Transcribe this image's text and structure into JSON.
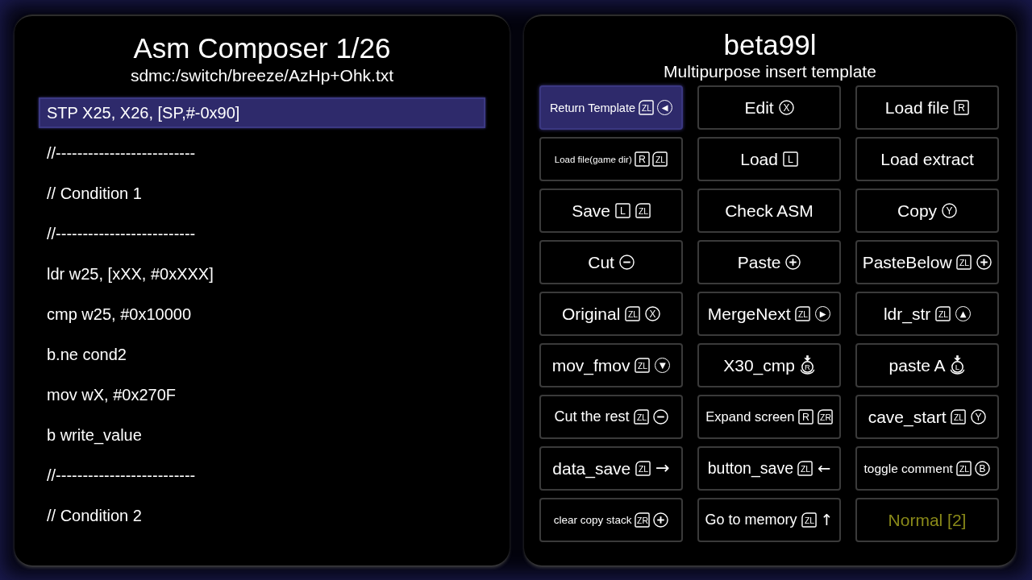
{
  "editor": {
    "title": "Asm Composer 1/26",
    "path": "sdmc:/switch/breeze/AzHp+Ohk.txt",
    "lines": [
      {
        "text": "STP X25, X26, [SP,#-0x90]",
        "selected": true
      },
      {
        "text": "//--------------------------",
        "selected": false
      },
      {
        "text": "// Condition 1",
        "selected": false
      },
      {
        "text": "//--------------------------",
        "selected": false
      },
      {
        "text": "ldr w25, [xXX, #0xXXX]",
        "selected": false
      },
      {
        "text": "cmp w25, #0x10000",
        "selected": false
      },
      {
        "text": "b.ne cond2",
        "selected": false
      },
      {
        "text": "mov wX, #0x270F",
        "selected": false
      },
      {
        "text": "b write_value",
        "selected": false
      },
      {
        "text": "//--------------------------",
        "selected": false
      },
      {
        "text": "// Condition 2",
        "selected": false
      }
    ]
  },
  "template": {
    "title": "beta99l",
    "subtitle": "Multipurpose insert template",
    "buttons": [
      {
        "label": "Return Template",
        "keys": [
          {
            "kind": "trigger",
            "text": "ZL"
          },
          {
            "kind": "dpad",
            "text": "◀"
          }
        ],
        "selected": true,
        "color": "#ffffff"
      },
      {
        "label": "Edit",
        "keys": [
          {
            "kind": "face",
            "text": "X"
          }
        ],
        "selected": false,
        "color": "#ffffff"
      },
      {
        "label": "Load file",
        "keys": [
          {
            "kind": "bumper",
            "text": "R"
          }
        ],
        "selected": false,
        "color": "#ffffff"
      },
      {
        "label": "Load file(game dir)",
        "keys": [
          {
            "kind": "bumper",
            "text": "R"
          },
          {
            "kind": "trigger",
            "text": "ZL"
          }
        ],
        "selected": false,
        "color": "#ffffff"
      },
      {
        "label": "Load",
        "keys": [
          {
            "kind": "bumper",
            "text": "L"
          }
        ],
        "selected": false,
        "color": "#ffffff"
      },
      {
        "label": "Load extract",
        "selected": false,
        "color": "#ffffff"
      },
      {
        "label": "Save",
        "keys": [
          {
            "kind": "bumper",
            "text": "L"
          },
          {
            "kind": "trigger",
            "text": "ZL"
          }
        ],
        "selected": false,
        "color": "#ffffff"
      },
      {
        "label": "Check ASM",
        "selected": false,
        "color": "#ffffff"
      },
      {
        "label": "Copy",
        "keys": [
          {
            "kind": "face",
            "text": "Y"
          }
        ],
        "selected": false,
        "color": "#ffffff"
      },
      {
        "label": "Cut",
        "keys": [
          {
            "kind": "minus"
          }
        ],
        "selected": false,
        "color": "#ffffff"
      },
      {
        "label": "Paste",
        "keys": [
          {
            "kind": "plus"
          }
        ],
        "selected": false,
        "color": "#ffffff"
      },
      {
        "label": "PasteBelow",
        "keys": [
          {
            "kind": "trigger",
            "text": "ZL"
          },
          {
            "kind": "plus"
          }
        ],
        "selected": false,
        "color": "#ffffff"
      },
      {
        "label": "Original",
        "keys": [
          {
            "kind": "trigger",
            "text": "ZL"
          },
          {
            "kind": "face",
            "text": "X"
          }
        ],
        "selected": false,
        "color": "#ffffff"
      },
      {
        "label": "MergeNext",
        "keys": [
          {
            "kind": "trigger",
            "text": "ZL"
          },
          {
            "kind": "dpad",
            "text": "▶"
          }
        ],
        "selected": false,
        "color": "#ffffff"
      },
      {
        "label": "ldr_str",
        "keys": [
          {
            "kind": "trigger",
            "text": "ZL"
          },
          {
            "kind": "dpad",
            "text": "▲"
          }
        ],
        "selected": false,
        "color": "#ffffff"
      },
      {
        "label": "mov_fmov",
        "keys": [
          {
            "kind": "trigger",
            "text": "ZL"
          },
          {
            "kind": "dpad",
            "text": "▼"
          }
        ],
        "selected": false,
        "color": "#ffffff"
      },
      {
        "label": "X30_cmp",
        "keys": [
          {
            "kind": "stick",
            "text": "R"
          }
        ],
        "selected": false,
        "color": "#ffffff"
      },
      {
        "label": "paste A",
        "keys": [
          {
            "kind": "stick",
            "text": "L"
          }
        ],
        "selected": false,
        "color": "#ffffff"
      },
      {
        "label": "Cut the rest",
        "keys": [
          {
            "kind": "trigger",
            "text": "ZL"
          },
          {
            "kind": "minus"
          }
        ],
        "selected": false,
        "color": "#ffffff"
      },
      {
        "label": "Expand screen",
        "keys": [
          {
            "kind": "bumper",
            "text": "R"
          },
          {
            "kind": "trigger",
            "text": "ZR"
          }
        ],
        "selected": false,
        "color": "#ffffff"
      },
      {
        "label": "cave_start",
        "keys": [
          {
            "kind": "trigger",
            "text": "ZL"
          },
          {
            "kind": "face",
            "text": "Y"
          }
        ],
        "selected": false,
        "color": "#ffffff"
      },
      {
        "label": "data_save",
        "keys": [
          {
            "kind": "trigger",
            "text": "ZL"
          },
          {
            "kind": "arrow",
            "text": "→"
          }
        ],
        "selected": false,
        "color": "#ffffff"
      },
      {
        "label": "button_save",
        "keys": [
          {
            "kind": "trigger",
            "text": "ZL"
          },
          {
            "kind": "arrow",
            "text": "←"
          }
        ],
        "selected": false,
        "color": "#ffffff"
      },
      {
        "label": "toggle comment",
        "keys": [
          {
            "kind": "trigger",
            "text": "ZL"
          },
          {
            "kind": "face",
            "text": "B"
          }
        ],
        "selected": false,
        "color": "#ffffff"
      },
      {
        "label": "clear copy stack",
        "keys": [
          {
            "kind": "trigger",
            "text": "ZR"
          },
          {
            "kind": "plus"
          }
        ],
        "selected": false,
        "color": "#ffffff"
      },
      {
        "label": "Go to memory",
        "keys": [
          {
            "kind": "trigger",
            "text": "ZL"
          },
          {
            "kind": "arrow",
            "text": "↑"
          }
        ],
        "selected": false,
        "color": "#ffffff"
      },
      {
        "label": "Normal [2]",
        "selected": false,
        "color": "#8a8a19"
      }
    ]
  }
}
